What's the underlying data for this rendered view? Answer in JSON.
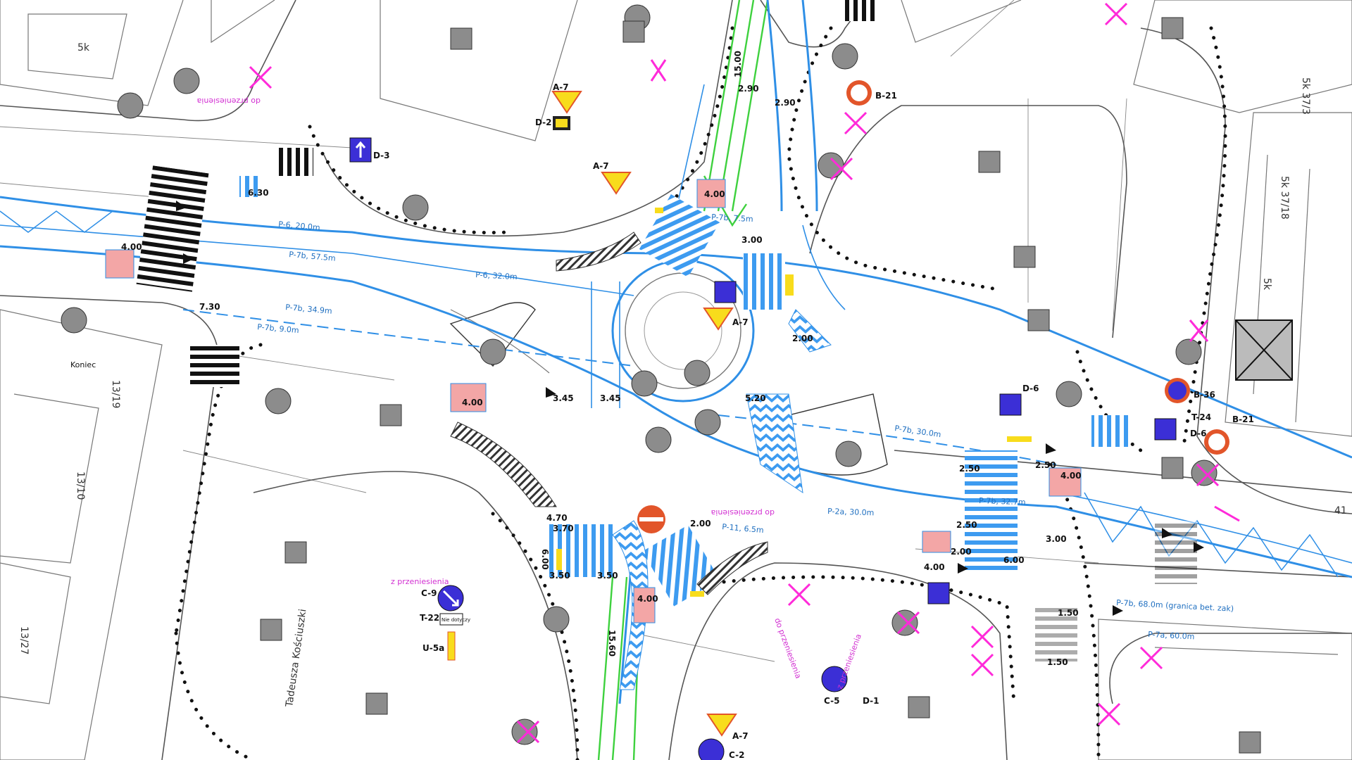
{
  "sign_codes": [
    "A-7",
    "A-7",
    "A-7",
    "D-2",
    "D-3",
    "B-21",
    "B-21",
    "B-36",
    "T-24",
    "D-6",
    "D-6",
    "C-9",
    "T-22",
    "U-5a",
    "C-5",
    "D-1",
    "C-2"
  ],
  "note_labels": [
    "do przeniesienia",
    "z przeniesienia",
    "do przeniesienia",
    "z przeniesienia",
    "do przeniesienia"
  ],
  "sign_text": {
    "t22_plate": "Nie dotyczy",
    "koniec": "Koniec"
  },
  "dims": [
    "4.00",
    "4.00",
    "4.00",
    "4.00",
    "4.00",
    "4.00",
    "3.00",
    "3.00",
    "3.50",
    "3.50",
    "3.45",
    "3.45",
    "2.50",
    "2.50",
    "2.50",
    "2.00",
    "2.00",
    "2.00",
    "1.50",
    "1.50",
    "6.00",
    "6.00",
    "7.30",
    "6.30",
    "5.20",
    "4.70",
    "3.70",
    "15.60",
    "15.00",
    "2.90",
    "2.90"
  ],
  "lane_labels": [
    "P-6, 32.0m",
    "P-7b, 57.5m",
    "P-6, 20.0m",
    "P-7b, 34.9m",
    "P-7b, 9.0m",
    "P-7b, 30.0m",
    "P-7b, 32.7m",
    "P-2a, 30.0m",
    "P-7b, 68.0m (granica bet. zak)",
    "P-7a, 60.0m",
    "P-11, 6.5m",
    "P-7b, 7.5m"
  ],
  "street_name": "Tadeusza Kościuszki",
  "block_labels": [
    "5k",
    "5k 37/3",
    "5k 37/18",
    "13/19",
    "13/10",
    "13/27",
    "5k",
    "41"
  ],
  "colors": {
    "cycle_lane": "#2f8fe6",
    "crossing": "#3d9bf0",
    "cycle_path": "#f3a6a6",
    "tram": "#3ed13e",
    "sign_blue": "#3b2fd6",
    "sign_yellow": "#f8dc1c",
    "sign_red": "#e2552a",
    "removed": "#ff2ad9",
    "grey_sign": "#8c8c8c"
  }
}
